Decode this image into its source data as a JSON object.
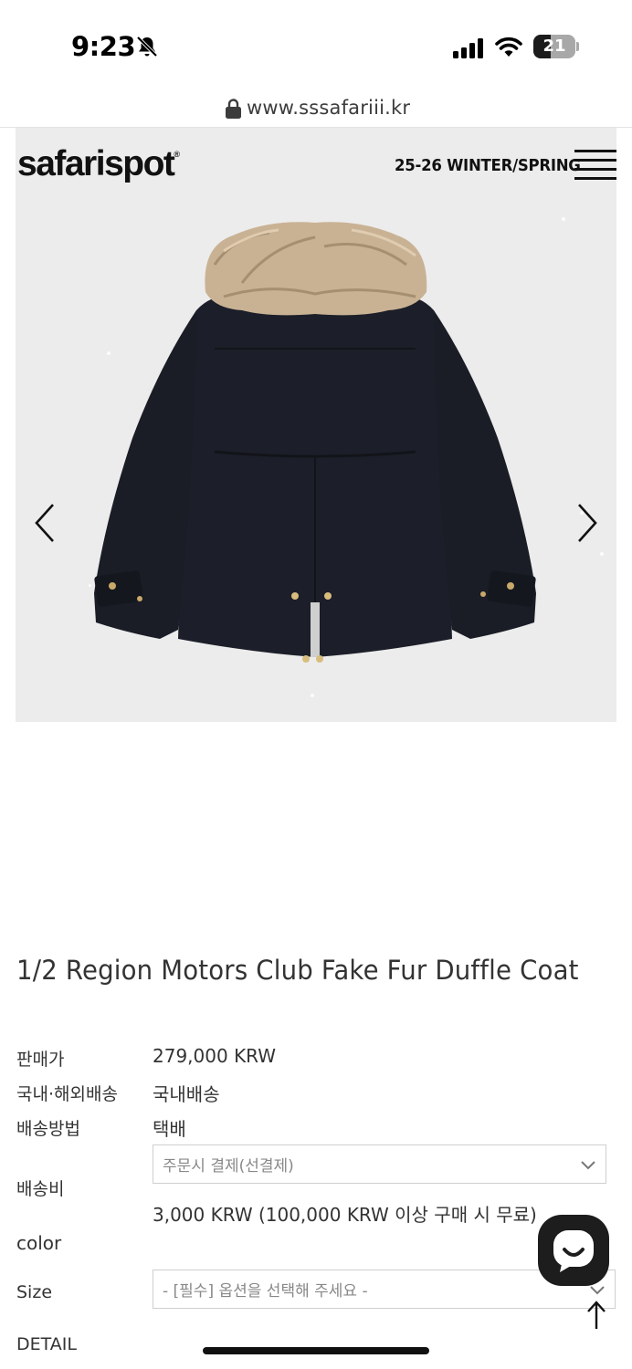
{
  "status_bar": {
    "time": "9:23",
    "battery": "21"
  },
  "browser": {
    "url": "www.sssafariii.kr"
  },
  "header": {
    "logo": "safarispot",
    "logo_mark": "®",
    "season": "25-26 WINTER/SPRING"
  },
  "product": {
    "title": "1/2 Region Motors Club Fake Fur Duffle Coat",
    "rows": [
      {
        "label": "판매가",
        "value": "279,000 KRW"
      },
      {
        "label": "국내·해외배송",
        "value": "국내배송"
      },
      {
        "label": "배송방법",
        "value": "택배"
      },
      {
        "label": "배송비",
        "select": "주문시 결제(선결제)",
        "value": "3,000 KRW (100,000 KRW 이상 구매 시 무료)"
      },
      {
        "label": "color"
      },
      {
        "label": "Size",
        "select": "- [필수] 옵션을 선택해 주세요 -"
      },
      {
        "label": "DETAIL"
      }
    ]
  },
  "colors": {
    "hero_bg": "#ececec",
    "coat": "#1c1f29",
    "fur": "#c9b294",
    "chat_button": "#1d1d1d"
  }
}
